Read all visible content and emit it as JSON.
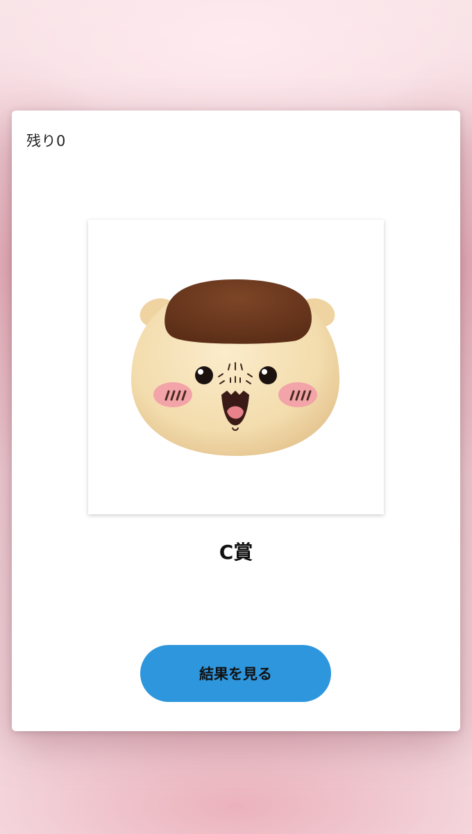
{
  "modal": {
    "remaining_label": "残り0",
    "prize_name": "C賞",
    "result_button_label": "結果を見る"
  },
  "image": {
    "subject": "plush-character-face",
    "colors": {
      "face": "#f3dcad",
      "hair": "#6e3a1f",
      "cheek": "#f2a4a8",
      "accent_button": "#2e96dd"
    }
  }
}
